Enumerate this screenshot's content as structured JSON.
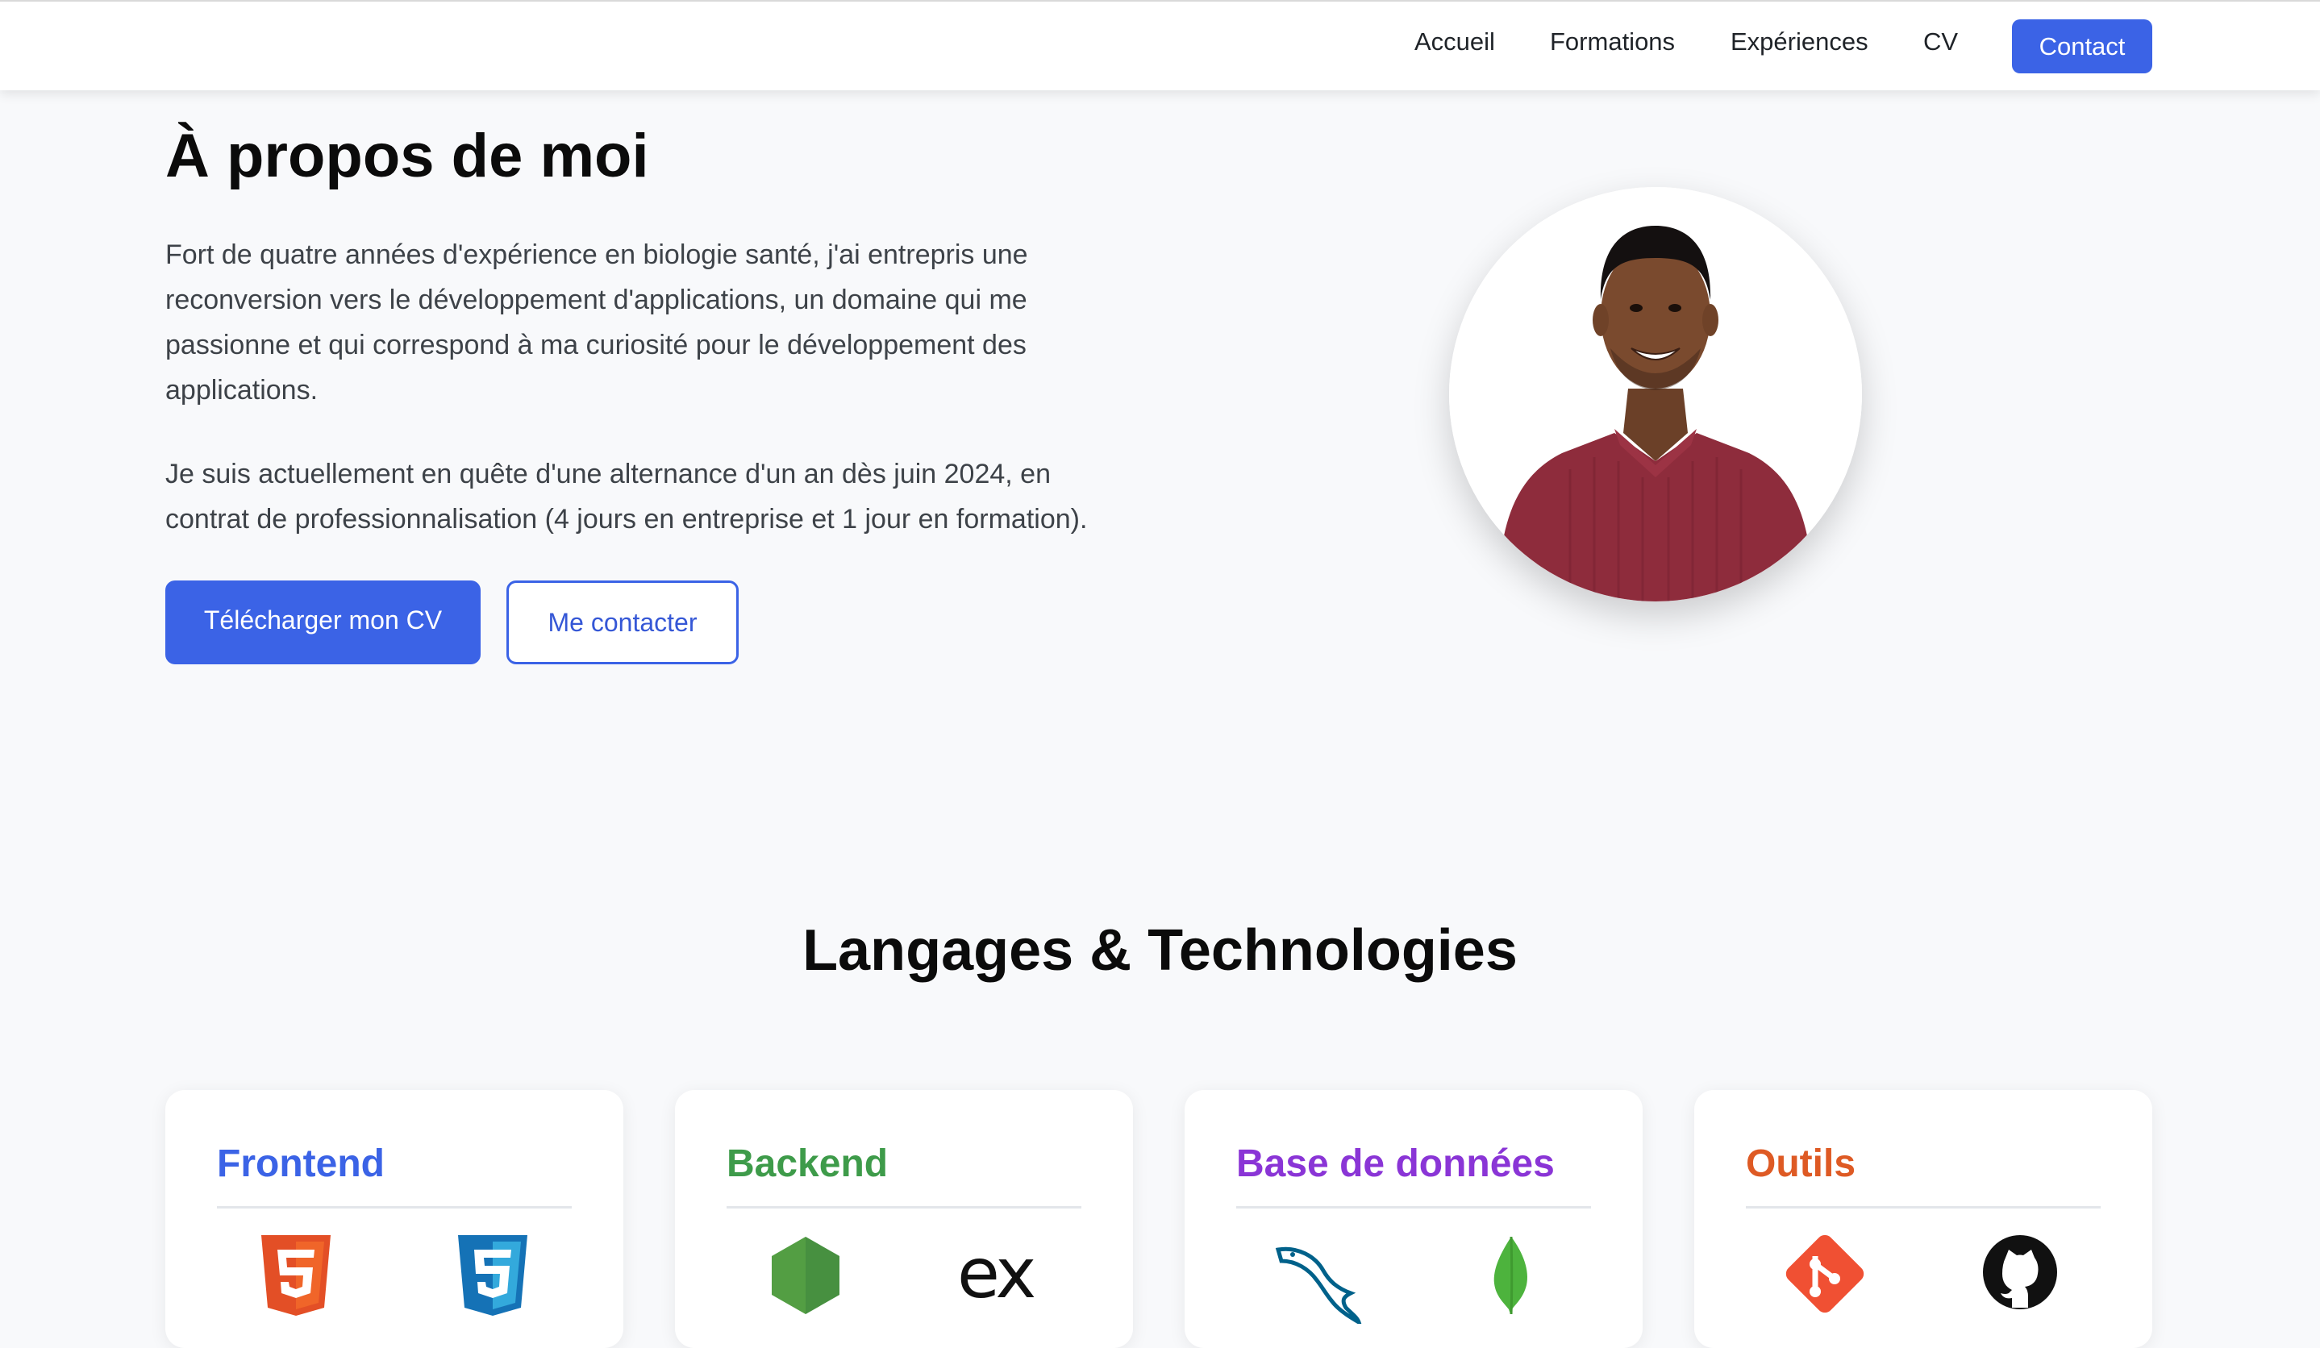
{
  "nav": {
    "links": [
      "Accueil",
      "Formations",
      "Expériences",
      "CV"
    ],
    "cta": "Contact"
  },
  "about": {
    "title": "À propos de moi",
    "paragraph1_lines": [
      "Fort de quatre années d'expérience en biologie santé, j'ai entrepris une",
      "reconversion vers le développement d'applications, un domaine qui me",
      "passionne et qui correspond à ma curiosité pour le développement des",
      "applications."
    ],
    "paragraph2_lines": [
      "Je suis actuellement en quête d'une alternance d'un an dès juin 2024, en",
      "contrat de professionnalisation (4 jours en entreprise et 1 jour en formation)."
    ],
    "btn_download": "Télécharger mon CV",
    "btn_contact": "Me contacter"
  },
  "skills": {
    "title": "Langages & Technologies",
    "cards": [
      {
        "title": "Frontend",
        "color": "#3b63e6",
        "icons": [
          "html5-icon",
          "css3-icon"
        ]
      },
      {
        "title": "Backend",
        "color": "#3e9b4a",
        "icons": [
          "nodejs-icon",
          "express-icon"
        ]
      },
      {
        "title": "Base de données",
        "color": "#8a35d6",
        "icons": [
          "mysql-icon",
          "mongodb-icon"
        ]
      },
      {
        "title": "Outils",
        "color": "#de5a24",
        "icons": [
          "git-icon",
          "github-icon"
        ]
      }
    ]
  },
  "icons": {
    "express_text": "ex"
  }
}
